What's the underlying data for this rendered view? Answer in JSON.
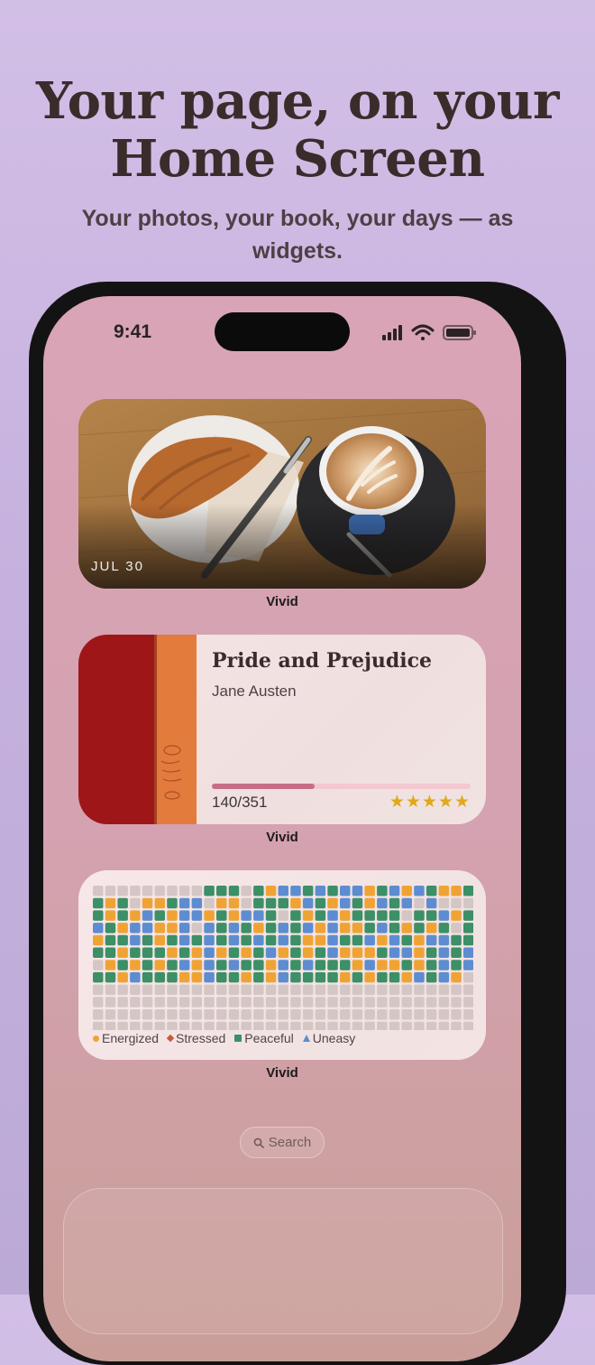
{
  "header": {
    "headline": [
      "Your page, on your",
      "Home Screen"
    ],
    "subhead": "Your photos, your book, your days — as widgets."
  },
  "status_bar": {
    "time": "9:41",
    "icons": [
      "cellular-signal-icon",
      "wifi-icon",
      "battery-icon"
    ]
  },
  "widgets": {
    "photo": {
      "date": "JUL 30",
      "caption": "Vivid",
      "image_description_icon": "croissant-and-latte-photo"
    },
    "book": {
      "title": "Pride and Prejudice",
      "author": "Jane Austen",
      "progress_text": "140/351",
      "pages_read": 140,
      "pages_total": 351,
      "rating": 5,
      "stars": "★★★★★",
      "caption": "Vivid"
    },
    "mood": {
      "caption": "Vivid",
      "legend": [
        {
          "label": "Energized",
          "color": "#f0a335"
        },
        {
          "label": "Stressed",
          "color": "#c55a42"
        },
        {
          "label": "Peaceful",
          "color": "#3c8f66"
        },
        {
          "label": "Uneasy",
          "color": "#5d8dd0"
        }
      ],
      "columns": 31,
      "rows": 12,
      "grid": [
        "eeeeeeeeegggegpubgbgbbpgbpbgppg",
        "gpgeppgbbeppegggpbgpbgpbgbebeeee",
        "gpgpbgpbbpgpbbgegpgbpggggeggbpgg",
        "bgpbbppbebgbgpgbgbpbppgbgpgpgeg",
        "pggbgpgbgbgbgbgbgppbggbpbgpbbgg",
        "ggpgggpgpbpgpgbpgpgbpppgbbpgbgb",
        "epgpgpgbpbgbggpbgbgggpbppgpgbgb",
        "ggpbgggppbggpgpbggggpgpggpbgbpe",
        "eeeeeeeeeeeeeeeeeeeeeeeeeeeeeee",
        "eeeeeeeeeeeeeeeeeeeeeeeeeeeeeee",
        "eeeeeeeeeeeeeeeeeeeeeeeeeeeeeee",
        "eeeeeeeeeeeeeeeeeeeeeeeeeeeeeee"
      ],
      "cell_colors": {
        "g": "#3c8f66",
        "p": "#f0a335",
        "b": "#5d8dd0",
        "u": "#5d8dd0",
        "e": "#d5c6c6"
      }
    }
  },
  "search": {
    "label": "Search"
  },
  "colors": {
    "background": "#cdb9e2",
    "screen": "#d6a3b4",
    "progress": "#c66e87",
    "stars": "#e0a81d"
  }
}
